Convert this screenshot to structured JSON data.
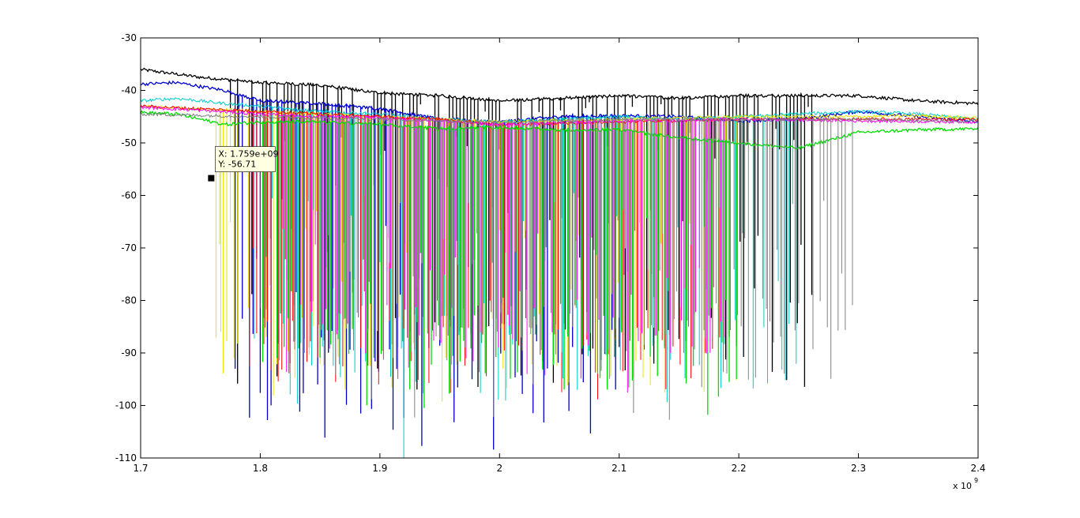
{
  "chart_data": {
    "type": "line",
    "title": "",
    "xlabel": "",
    "ylabel": "",
    "xlim": [
      1.7,
      2.4
    ],
    "ylim": [
      -110,
      -30
    ],
    "x_unit_multiplier_label": "x 10",
    "x_unit_exponent": "9",
    "x_ticks": [
      "1.7",
      "1.8",
      "1.9",
      "2",
      "2.1",
      "2.2",
      "2.3",
      "2.4"
    ],
    "y_ticks": [
      "-30",
      "-40",
      "-50",
      "-60",
      "-70",
      "-80",
      "-90",
      "-100",
      "-110"
    ],
    "grid": false,
    "legend": "none",
    "series": [
      {
        "color": "#000000",
        "baseline": [
          [
            1.7,
            -36
          ],
          [
            1.75,
            -37.5
          ],
          [
            1.8,
            -38.5
          ],
          [
            1.85,
            -39
          ],
          [
            1.9,
            -40.5
          ],
          [
            1.95,
            -41
          ],
          [
            2.0,
            -42
          ],
          [
            2.05,
            -41.5
          ],
          [
            2.1,
            -41
          ],
          [
            2.15,
            -41.5
          ],
          [
            2.2,
            -41
          ],
          [
            2.25,
            -41
          ],
          [
            2.3,
            -41
          ],
          [
            2.35,
            -42
          ],
          [
            2.4,
            -42.5
          ]
        ],
        "spike_range": [
          1.775,
          2.265
        ],
        "spike_depths": [
          -46,
          -90,
          -84,
          -47,
          -86,
          -70,
          -91,
          -45,
          -80,
          -62,
          -88,
          -47
        ]
      },
      {
        "color": "#0000cc",
        "baseline": [
          [
            1.7,
            -38.8
          ],
          [
            1.73,
            -38.5
          ],
          [
            1.77,
            -40
          ],
          [
            1.8,
            -42
          ],
          [
            1.85,
            -42.5
          ],
          [
            1.9,
            -43.5
          ],
          [
            1.95,
            -45.5
          ],
          [
            2.0,
            -46
          ],
          [
            2.05,
            -45
          ],
          [
            2.1,
            -44.8
          ],
          [
            2.15,
            -45
          ],
          [
            2.2,
            -45.8
          ],
          [
            2.25,
            -45.5
          ],
          [
            2.3,
            -44
          ],
          [
            2.35,
            -45
          ],
          [
            2.4,
            -46
          ]
        ],
        "spike_range": [
          1.775,
          2.1
        ],
        "spike_depths": [
          -88,
          -60,
          -84,
          -99,
          -92,
          -75,
          -101,
          -86,
          -104,
          -95
        ]
      },
      {
        "color": "#00cccc",
        "baseline": [
          [
            1.7,
            -42
          ],
          [
            1.73,
            -41.5
          ],
          [
            1.77,
            -42.5
          ],
          [
            1.8,
            -43
          ],
          [
            1.85,
            -44
          ],
          [
            1.9,
            -44.5
          ],
          [
            1.95,
            -45.5
          ],
          [
            2.0,
            -46
          ],
          [
            2.05,
            -45.5
          ],
          [
            2.1,
            -45
          ],
          [
            2.15,
            -45.5
          ],
          [
            2.2,
            -45
          ],
          [
            2.25,
            -44.5
          ],
          [
            2.3,
            -44
          ],
          [
            2.35,
            -44.5
          ],
          [
            2.4,
            -45.5
          ]
        ],
        "spike_range": [
          1.79,
          2.25
        ],
        "spike_depths": [
          -87,
          -64,
          -92,
          -80,
          -93,
          -78,
          -95,
          -92
        ],
        "extreme": {
          "x": 1.92,
          "y": -110
        }
      },
      {
        "color": "#e6e600",
        "baseline": [
          [
            1.7,
            -43
          ],
          [
            1.75,
            -43.5
          ],
          [
            1.8,
            -44
          ],
          [
            1.85,
            -44.5
          ],
          [
            1.9,
            -45
          ],
          [
            1.95,
            -45.5
          ],
          [
            2.0,
            -46
          ],
          [
            2.1,
            -45.5
          ],
          [
            2.2,
            -45
          ],
          [
            2.3,
            -45
          ],
          [
            2.35,
            -44.8
          ],
          [
            2.4,
            -45.3
          ]
        ],
        "spike_range": [
          1.76,
          2.2
        ],
        "spike_depths": [
          -85,
          -72,
          -94,
          -88,
          -66,
          -90,
          -92,
          -80
        ],
        "extreme": {
          "x": 1.767,
          "y": -86
        }
      },
      {
        "color": "#ff0000",
        "baseline": [
          [
            1.7,
            -43
          ],
          [
            1.75,
            -43.5
          ],
          [
            1.8,
            -44
          ],
          [
            1.85,
            -44.5
          ],
          [
            1.9,
            -45
          ],
          [
            1.95,
            -45.5
          ],
          [
            2.0,
            -46.5
          ],
          [
            2.1,
            -46
          ],
          [
            2.2,
            -45.5
          ],
          [
            2.3,
            -45.5
          ],
          [
            2.4,
            -45.5
          ]
        ],
        "spike_range": [
          1.79,
          2.19
        ],
        "spike_depths": [
          -88,
          -69,
          -91,
          -82,
          -94,
          -86,
          -90,
          -92
        ]
      },
      {
        "color": "#ff00ff",
        "baseline": [
          [
            1.7,
            -43.2
          ],
          [
            1.75,
            -43.8
          ],
          [
            1.8,
            -44.5
          ],
          [
            1.85,
            -45
          ],
          [
            1.9,
            -45.2
          ],
          [
            1.95,
            -45.8
          ],
          [
            2.0,
            -46.5
          ],
          [
            2.1,
            -45.8
          ],
          [
            2.2,
            -45.5
          ],
          [
            2.3,
            -45.8
          ],
          [
            2.4,
            -46
          ]
        ],
        "spike_range": [
          1.8,
          2.2
        ],
        "spike_depths": [
          -84,
          -72,
          -90,
          -86,
          -88,
          -78,
          -92
        ]
      },
      {
        "color": "#00dd00",
        "baseline": [
          [
            1.7,
            -44.2
          ],
          [
            1.73,
            -44.5
          ],
          [
            1.77,
            -46.5
          ],
          [
            1.8,
            -46
          ],
          [
            1.85,
            -46
          ],
          [
            1.9,
            -46.5
          ],
          [
            1.95,
            -47.3
          ],
          [
            2.0,
            -47
          ],
          [
            2.05,
            -47.5
          ],
          [
            2.1,
            -47.5
          ],
          [
            2.15,
            -49
          ],
          [
            2.2,
            -50
          ],
          [
            2.25,
            -51
          ],
          [
            2.3,
            -48
          ],
          [
            2.35,
            -47.5
          ],
          [
            2.4,
            -47.3
          ]
        ],
        "spike_range": [
          1.8,
          2.2
        ],
        "spike_depths": [
          -90,
          -68,
          -96,
          -82,
          -94,
          -88,
          -84,
          -92
        ]
      },
      {
        "color": "#808080",
        "baseline": [
          [
            1.7,
            -44.5
          ],
          [
            1.8,
            -45
          ],
          [
            1.9,
            -45.5
          ],
          [
            2.0,
            -46
          ],
          [
            2.1,
            -45.5
          ],
          [
            2.2,
            -45.5
          ],
          [
            2.25,
            -45.5
          ],
          [
            2.3,
            -45.5
          ],
          [
            2.4,
            -46
          ]
        ],
        "spike_range": [
          1.85,
          2.3
        ],
        "spike_depths": [
          -84,
          -65,
          -90,
          -97,
          -84,
          -78,
          -85
        ]
      }
    ],
    "datatip": {
      "x_text": "X: 1.759e+09",
      "y_text": "Y: -56.71",
      "x": 1.759,
      "y": -56.71
    }
  }
}
